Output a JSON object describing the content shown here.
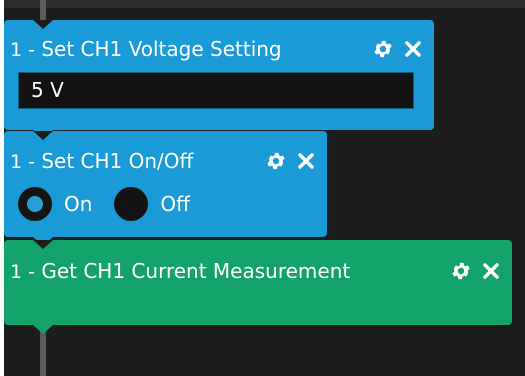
{
  "blocks": [
    {
      "index": "1 -",
      "title": "Set CH1 Voltage Setting",
      "value": "5 V",
      "settings_icon": "gear-icon",
      "close_icon": "close-icon"
    },
    {
      "index": "1 -",
      "title": "Set CH1 On/Off",
      "options": [
        {
          "label": "On",
          "selected": true
        },
        {
          "label": "Off",
          "selected": false
        }
      ],
      "settings_icon": "gear-icon",
      "close_icon": "close-icon"
    },
    {
      "index": "1 -",
      "title": "Get CH1 Current Measurement",
      "settings_icon": "gear-icon",
      "close_icon": "close-icon"
    }
  ],
  "colors": {
    "background": "#1c1c1c",
    "set_block": "#1a9ad6",
    "get_block": "#13a36a",
    "connector": "#5b5b5b",
    "radio_selected": "#2a9fd6"
  }
}
